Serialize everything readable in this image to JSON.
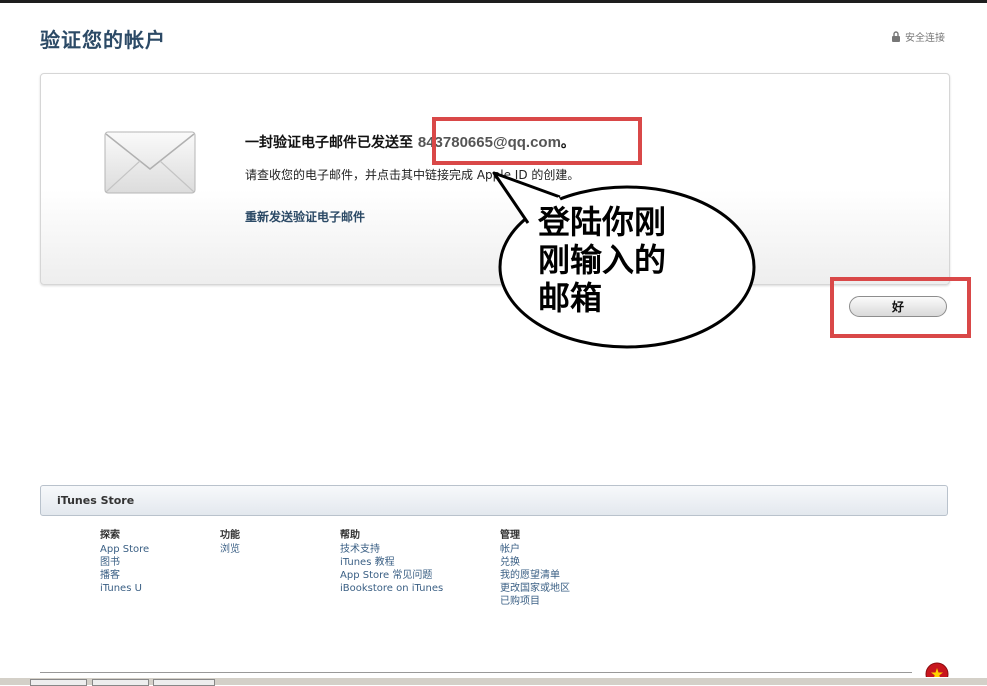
{
  "page": {
    "title": "验证您的帐户",
    "secure_label": "安全连接"
  },
  "message": {
    "title_prefix": "一封验证电子邮件已发送至 ",
    "email": "843780665@qq.com",
    "title_suffix": "。",
    "body": "请查收您的电子邮件，并点击其中链接完成 Apple ID 的创建。",
    "resend_link": "重新发送验证电子邮件"
  },
  "annotation": {
    "line1": "登陆你刚",
    "line2": "刚输入的",
    "line3": "邮箱"
  },
  "ok_button": {
    "label": "好"
  },
  "footer": {
    "store_title": "iTunes Store",
    "columns": [
      {
        "heading": "探索",
        "links": [
          "App Store",
          "图书",
          "播客",
          "iTunes U"
        ]
      },
      {
        "heading": "功能",
        "links": [
          "浏览"
        ]
      },
      {
        "heading": "帮助",
        "links": [
          "技术支持",
          "iTunes 教程",
          "App Store 常见问题",
          "iBookstore on iTunes"
        ]
      },
      {
        "heading": "管理",
        "links": [
          "帐户",
          "兑换",
          "我的愿望清单",
          "更改国家或地区",
          "已购项目"
        ]
      }
    ]
  },
  "colors": {
    "title": "#2c4a66",
    "highlight": "#d94848",
    "link": "#3a5f84"
  },
  "icons": [
    "lock-icon",
    "envelope-icon",
    "flag-badge-icon"
  ]
}
